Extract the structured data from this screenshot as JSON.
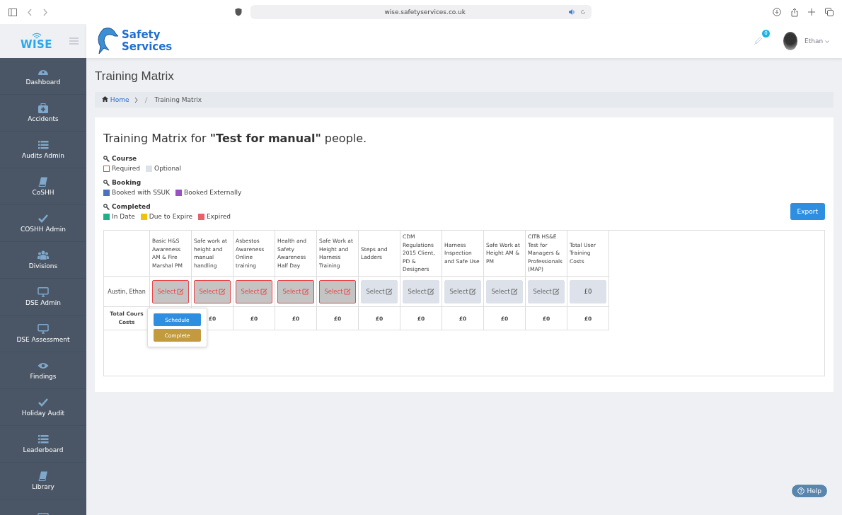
{
  "browser": {
    "url": "wise.safetyservices.co.uk"
  },
  "brand": {
    "logo": "WISE",
    "name_line1": "Safety",
    "name_line2": "Services"
  },
  "header": {
    "notifications": "0",
    "user": "Ethan"
  },
  "sidebar": {
    "items": [
      {
        "label": "Dashboard",
        "kind": "gauge"
      },
      {
        "label": "Accidents",
        "kind": "medkit"
      },
      {
        "label": "Audits Admin",
        "kind": "list"
      },
      {
        "label": "CoSHH",
        "kind": "book"
      },
      {
        "label": "COSHH Admin",
        "kind": "check"
      },
      {
        "label": "Divisions",
        "kind": "users"
      },
      {
        "label": "DSE Admin",
        "kind": "monitor"
      },
      {
        "label": "DSE Assessment",
        "kind": "monitor"
      },
      {
        "label": "Findings",
        "kind": "eye"
      },
      {
        "label": "Holiday Audit",
        "kind": "check"
      },
      {
        "label": "Leaderboard",
        "kind": "list"
      },
      {
        "label": "Library",
        "kind": "book"
      },
      {
        "kind": "monitor"
      }
    ]
  },
  "page_title": "Training Matrix",
  "breadcrumb": [
    "Home",
    "Training Matrix"
  ],
  "card": {
    "heading": "Training Matrix for **\"Test for manual\"** people.",
    "legend": [
      {
        "title": "Course",
        "items": [
          {
            "label": "Required",
            "color": "#e8464a",
            "kind": "outline"
          },
          {
            "label": "Optional",
            "color": "#dde2ea",
            "kind": "fill"
          }
        ]
      },
      {
        "title": "Booking",
        "items": [
          {
            "label": "Booked with SSUK",
            "color": "#4a72c0",
            "kind": "fill"
          },
          {
            "label": "Booked Externally",
            "color": "#9a4fc4",
            "kind": "fill"
          }
        ]
      },
      {
        "title": "Completed",
        "items": [
          {
            "label": "In Date",
            "color": "#1fb08a",
            "kind": "fill"
          },
          {
            "label": "Due to Expire",
            "color": "#f0c20c",
            "kind": "fill"
          },
          {
            "label": "Expired",
            "color": "#e8606a",
            "kind": "fill"
          }
        ]
      }
    ],
    "export": "Export",
    "table": {
      "columns": [
        "Basic H&S Awareness AM & Fire Marshal PM",
        "Safe work at height and manual handling",
        "Asbestos Awareness Online training",
        "Health and Safety Awareness Half Day",
        "Safe Work at Height and Harness Training",
        "Steps and Ladders",
        "CDM Regulations 2015 Client, PD & Designers",
        "Harness Inspection and Safe Use",
        "Safe Work at Height AM & PM",
        "CITB HS&E Test for Managers & Professionals (MAP)"
      ],
      "total_column": "Total User Training Costs",
      "rows": [
        {
          "name": "Austin, Ethan",
          "cells": [
            {
              "text": "Select",
              "required": true
            },
            {
              "text": "Select",
              "required": true
            },
            {
              "text": "Select",
              "required": true
            },
            {
              "text": "Select",
              "required": true
            },
            {
              "text": "Select",
              "required": true
            },
            {
              "text": "Select",
              "required": false
            },
            {
              "text": "Select",
              "required": false
            },
            {
              "text": "Select",
              "required": false
            },
            {
              "text": "Select",
              "required": false
            },
            {
              "text": "Select",
              "required": false
            }
          ],
          "total": "£0"
        }
      ],
      "footer_label": "Total Cours\nCosts",
      "footer_values": [
        "£0",
        "£0",
        "£0",
        "£0",
        "£0",
        "£0",
        "£0",
        "£0",
        "£0",
        "£0"
      ]
    },
    "popover": {
      "buttons": [
        {
          "label": "Schedule",
          "kind": "primary"
        },
        {
          "label": "Complete",
          "kind": "warning"
        }
      ]
    }
  },
  "help": "Help"
}
